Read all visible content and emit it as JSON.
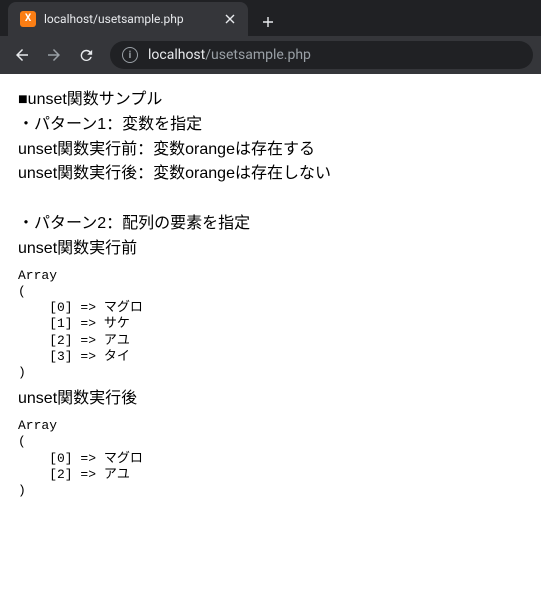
{
  "tab": {
    "title": "localhost/usetsample.php",
    "favicon_letter": "X"
  },
  "url": {
    "host": "localhost",
    "path": "/usetsample.php"
  },
  "content": {
    "heading": "■unset関数サンプル",
    "pattern1_title": "・パターン1：変数を指定",
    "pattern1_before": "unset関数実行前：変数orangeは存在する",
    "pattern1_after": "unset関数実行後：変数orangeは存在しない",
    "pattern2_title": "・パターン2：配列の要素を指定",
    "pattern2_before_label": "unset関数実行前",
    "pattern2_before_dump": "Array\n(\n    [0] => マグロ\n    [1] => サケ\n    [2] => アユ\n    [3] => タイ\n)",
    "pattern2_after_label": "unset関数実行後",
    "pattern2_after_dump": "Array\n(\n    [0] => マグロ\n    [2] => アユ\n)"
  }
}
